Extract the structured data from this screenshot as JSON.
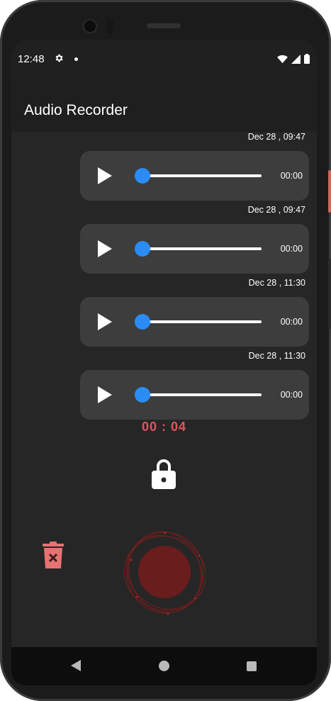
{
  "status_bar": {
    "time": "12:48"
  },
  "app_bar": {
    "title": "Audio Recorder"
  },
  "recordings": [
    {
      "timestamp": "Dec 28 , 09:47",
      "duration": "00:00",
      "progress": 0
    },
    {
      "timestamp": "Dec 28 , 09:47",
      "duration": "00:00",
      "progress": 0
    },
    {
      "timestamp": "Dec 28 , 11:30",
      "duration": "00:00",
      "progress": 0
    },
    {
      "timestamp": "Dec 28 , 11:30",
      "duration": "00:00",
      "progress": 0
    }
  ],
  "recorder": {
    "timer": "00 : 04",
    "timer_color": "#e2535b",
    "record_color": "#6a1d1d",
    "lock_icon": "lock-icon",
    "delete_icon": "trash-icon"
  },
  "colors": {
    "accent": "#2b8cf5",
    "bubble": "#3d3d3d",
    "background": "#262626",
    "delete": "#e57373"
  }
}
